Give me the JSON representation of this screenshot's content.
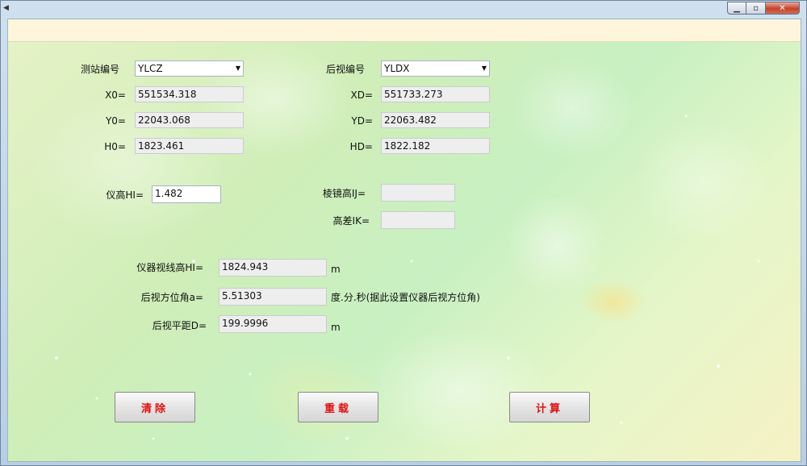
{
  "window": {
    "left_edge_icon": "left-arrow-icon",
    "buttons": {
      "minimize": "minimize-icon",
      "maximize": "maximize-icon",
      "close": "close-icon"
    }
  },
  "station": {
    "label": "测站编号",
    "value": "YLCZ",
    "x0_label": "X0=",
    "x0": "551534.318",
    "y0_label": "Y0=",
    "y0": "22043.068",
    "h0_label": "H0=",
    "h0": "1823.461"
  },
  "backsight": {
    "label": "后视编号",
    "value": "YLDX",
    "xd_label": "XD=",
    "xd": "551733.273",
    "yd_label": "YD=",
    "yd": "22063.482",
    "hd_label": "HD=",
    "hd": "1822.182"
  },
  "instrument_height": {
    "label": "仪高HI=",
    "value": "1.482"
  },
  "prism_height": {
    "label": "棱镜高IJ=",
    "value": ""
  },
  "height_diff": {
    "label": "高差IK=",
    "value": ""
  },
  "results": {
    "sight_height_label": "仪器视线高HI=",
    "sight_height": "1824.943",
    "sight_height_unit": "m",
    "azimuth_label": "后视方位角a=",
    "azimuth": "5.51303",
    "azimuth_unit": "度.分.秒(据此设置仪器后视方位角)",
    "distance_label": "后视平距D=",
    "distance": "199.9996",
    "distance_unit": "m"
  },
  "actions": {
    "clear": "清除",
    "reload": "重载",
    "calculate": "计算"
  },
  "colors": {
    "button_text": "#e01010"
  }
}
